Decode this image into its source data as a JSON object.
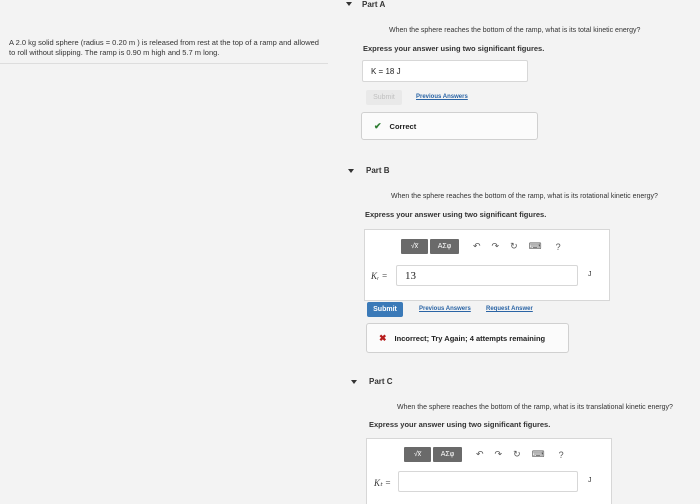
{
  "problem": {
    "text": "A 2.0 kg solid sphere (radius = 0.20 m ) is released from rest at the top of a ramp and allowed to roll without slipping. The ramp is 0.90 m high and 5.7 m long."
  },
  "part_a": {
    "title": "Part A",
    "question": "When the sphere reaches the bottom of the ramp, what is its total kinetic energy?",
    "instruction": "Express your answer using two significant figures.",
    "answer_text": "K =  18  J",
    "submit_label": "Submit",
    "previous_answers_label": "Previous Answers",
    "feedback": "Correct"
  },
  "part_b": {
    "title": "Part B",
    "question": "When the sphere reaches the bottom of the ramp, what is its rotational kinetic energy?",
    "instruction": "Express your answer using two significant figures.",
    "toolbar": {
      "template_label": "√x̅",
      "symbols_label": "ΑΣφ"
    },
    "variable_label": "Kᵣ =",
    "input_value": "13",
    "unit": "J",
    "submit_label": "Submit",
    "previous_answers_label": "Previous Answers",
    "request_answer_label": "Request Answer",
    "feedback": "Incorrect; Try Again; 4 attempts remaining"
  },
  "part_c": {
    "title": "Part C",
    "question": "When the sphere reaches the bottom of the ramp, what is its translational kinetic energy?",
    "instruction": "Express your answer using two significant figures.",
    "toolbar": {
      "template_label": "√x̅",
      "symbols_label": "ΑΣφ"
    },
    "variable_label": "Kₜ =",
    "input_value": "",
    "unit": "J"
  },
  "icons": {
    "undo": "↶",
    "redo": "↷",
    "reset": "↻",
    "keyboard": "⌨",
    "help": "?"
  }
}
